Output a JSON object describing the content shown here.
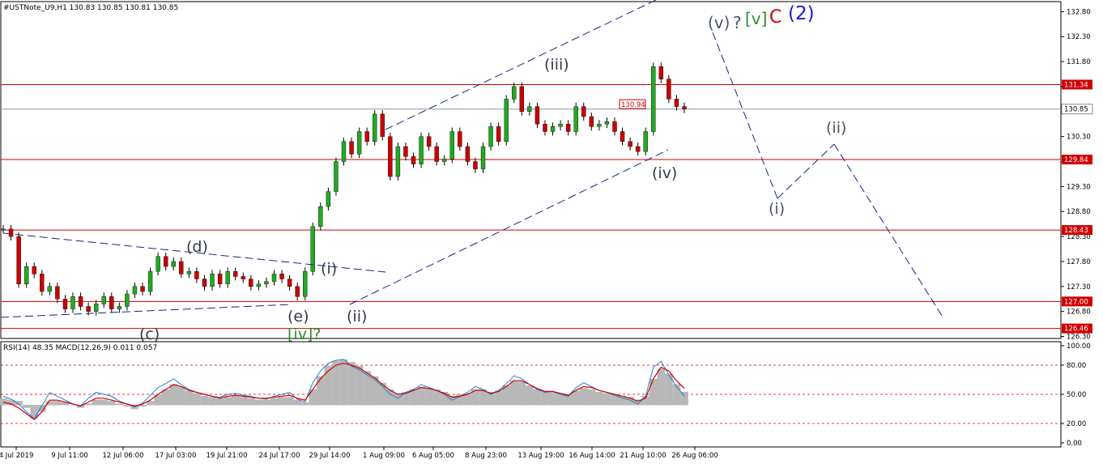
{
  "chart_data": [
    {
      "type": "candlestick",
      "symbol_header": "#USTNote_U9,H1  130.83 130.85 130.81 130.85",
      "ylim": [
        126.0,
        133.0
      ],
      "y_ticks": [
        "132.80",
        "132.30",
        "131.80",
        "131.30",
        "130.80",
        "130.30",
        "129.80",
        "129.30",
        "128.80",
        "128.30",
        "127.80",
        "127.30",
        "126.80",
        "126.30"
      ],
      "x_ticks": [
        "4 Jul 2019",
        "9 Jul 11:00",
        "12 Jul 06:00",
        "17 Jul 03:00",
        "19 Jul 21:00",
        "24 Jul 17:00",
        "29 Jul 14:00",
        "1 Aug 09:00",
        "6 Aug 05:00",
        "8 Aug 23:00",
        "13 Aug 19:00",
        "16 Aug 14:00",
        "21 Aug 10:00",
        "26 Aug 06:00"
      ],
      "current_price": {
        "value": 130.85,
        "label": "130.85"
      },
      "horizontal_lines": [
        {
          "value": 131.34,
          "label": "131.34"
        },
        {
          "value": 129.84,
          "label": "129.84"
        },
        {
          "value": 128.43,
          "label": "128.43"
        },
        {
          "value": 127.0,
          "label": "127.00"
        },
        {
          "value": 126.46,
          "label": "126.46"
        }
      ],
      "price_tag": {
        "value": 130.94,
        "label": "130.94"
      },
      "series": [
        {
          "values": [
            128.45,
            128.3,
            127.35,
            127.7,
            127.55,
            127.2,
            127.3,
            127.05,
            126.85,
            127.1,
            126.9,
            126.8,
            126.95,
            127.1,
            126.85,
            126.9,
            127.15,
            127.3,
            127.2,
            127.6,
            127.9,
            127.7,
            127.8,
            127.55,
            127.6,
            127.45,
            127.3,
            127.55,
            127.35,
            127.6,
            127.5,
            127.45,
            127.3,
            127.35,
            127.4,
            127.55,
            127.45,
            127.3,
            127.1,
            127.6,
            128.5,
            128.9,
            129.2,
            129.8,
            130.2,
            129.95,
            130.4,
            130.2,
            130.75,
            130.3,
            129.5,
            130.1,
            129.9,
            129.75,
            130.3,
            130.1,
            129.8,
            129.85,
            130.4,
            130.1,
            129.8,
            129.65,
            130.1,
            130.5,
            130.2,
            131.05,
            131.3,
            130.8,
            130.9,
            130.55,
            130.4,
            130.5,
            130.55,
            130.4,
            130.9,
            130.7,
            130.5,
            130.55,
            130.6,
            130.4,
            130.2,
            130.1,
            130.0,
            130.4,
            131.7,
            131.45,
            131.05,
            130.9,
            130.85
          ]
        }
      ],
      "annotations": [
        {
          "text": "(d)",
          "x": "17 Jul 06:00",
          "y": 128.0
        },
        {
          "text": "(c)",
          "x": "15 Jul 00:00",
          "y": 126.2
        },
        {
          "text": "(e)",
          "x": "25 Jul 12:00",
          "y": 126.75
        },
        {
          "text": "[iv]?",
          "x": "25 Jul 12:00",
          "y": 126.4
        },
        {
          "text": "(i)",
          "x": "29 Jul 10:00",
          "y": 127.65
        },
        {
          "text": "(ii)",
          "x": "30 Jul 12:00",
          "y": 126.75
        },
        {
          "text": "(iii)",
          "x": "14 Aug 00:00",
          "y": 131.75
        },
        {
          "text": "(iv)",
          "x": "23 Aug 18:00",
          "y": 129.6
        },
        {
          "text": "(v)",
          "x": "",
          "y": 132.4
        },
        {
          "text": "?",
          "x": "",
          "y": 132.4
        },
        {
          "text": "[v]",
          "x": "",
          "y": 132.4
        },
        {
          "text": "C",
          "x": "",
          "y": 132.4
        },
        {
          "text": "(2)",
          "x": "",
          "y": 132.4
        },
        {
          "text": "(i)",
          "x": "",
          "y": 128.9
        },
        {
          "text": "(ii)",
          "x": "",
          "y": 130.4
        }
      ]
    },
    {
      "type": "line",
      "header": "RSI(14) 48.35 MACD(12,26,9) 0.011 0.057",
      "ylim": [
        0,
        100
      ],
      "y_ticks": [
        "100.00",
        "80.00",
        "50.00",
        "20.00",
        "0.00"
      ],
      "levels": [
        80,
        50,
        20
      ],
      "series": [
        {
          "values": [
            48,
            45,
            40,
            32,
            25,
            38,
            52,
            48,
            44,
            40,
            38,
            46,
            52,
            50,
            48,
            43,
            40,
            37,
            41,
            49,
            57,
            61,
            66,
            60,
            55,
            52,
            50,
            48,
            47,
            50,
            51,
            49,
            48,
            46,
            45,
            48,
            50,
            52,
            45,
            42,
            62,
            74,
            82,
            85,
            86,
            79,
            75,
            70,
            65,
            58,
            50,
            46,
            52,
            55,
            60,
            57,
            54,
            50,
            44,
            48,
            52,
            58,
            55,
            50,
            54,
            61,
            69,
            66,
            60,
            55,
            52,
            53,
            50,
            48,
            57,
            62,
            58,
            54,
            52,
            49,
            46,
            44,
            40,
            48,
            78,
            84,
            70,
            58,
            48.35
          ]
        },
        {
          "values": [
            42,
            40,
            36,
            30,
            24,
            32,
            44,
            44,
            42,
            40,
            38,
            42,
            46,
            46,
            44,
            42,
            40,
            38,
            40,
            44,
            50,
            55,
            60,
            58,
            54,
            52,
            50,
            48,
            46,
            48,
            49,
            48,
            47,
            46,
            46,
            47,
            48,
            49,
            46,
            44,
            55,
            66,
            74,
            80,
            82,
            80,
            77,
            72,
            67,
            60,
            54,
            50,
            51,
            54,
            57,
            56,
            54,
            51,
            47,
            48,
            50,
            54,
            54,
            51,
            53,
            58,
            64,
            64,
            60,
            56,
            53,
            53,
            51,
            49,
            54,
            58,
            57,
            54,
            52,
            50,
            48,
            46,
            43,
            46,
            66,
            78,
            74,
            64,
            56
          ]
        },
        {
          "values": [
            5,
            4,
            3,
            -2,
            -10,
            -5,
            3,
            3,
            2,
            0,
            -2,
            1,
            4,
            4,
            3,
            1,
            -1,
            -3,
            -1,
            3,
            8,
            12,
            16,
            14,
            11,
            9,
            7,
            6,
            5,
            6,
            7,
            6,
            5,
            4,
            4,
            5,
            6,
            6,
            4,
            2,
            12,
            22,
            30,
            34,
            35,
            33,
            30,
            26,
            22,
            17,
            12,
            9,
            10,
            12,
            14,
            13,
            12,
            10,
            7,
            8,
            9,
            12,
            12,
            10,
            11,
            15,
            19,
            18,
            15,
            12,
            10,
            10,
            9,
            8,
            11,
            13,
            12,
            10,
            9,
            8,
            7,
            6,
            4,
            7,
            20,
            28,
            24,
            16,
            10
          ]
        }
      ]
    }
  ]
}
